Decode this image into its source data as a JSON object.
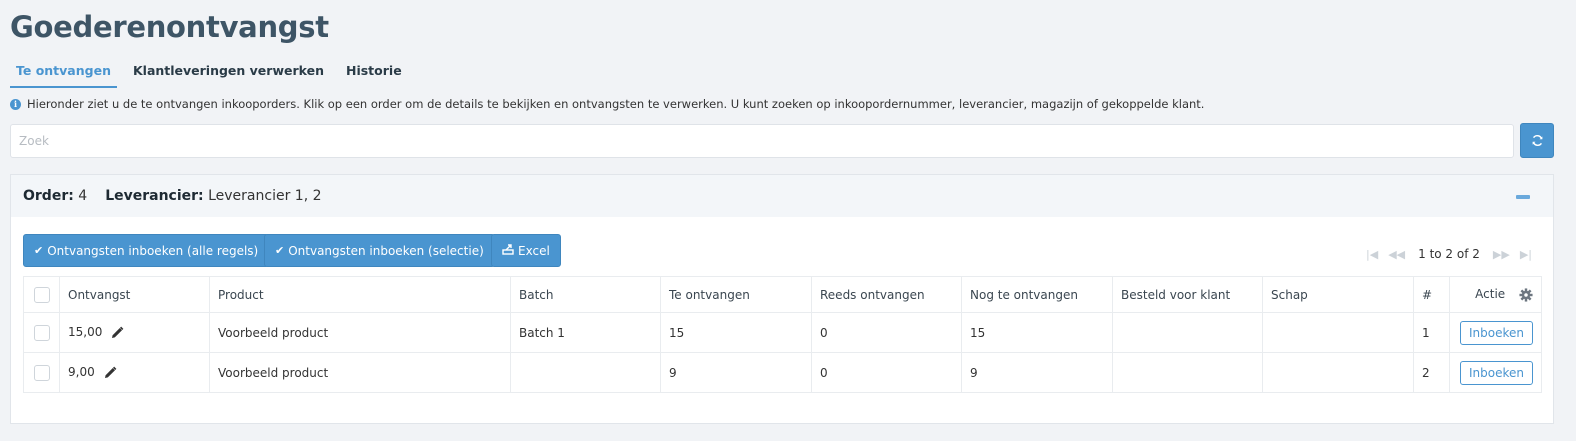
{
  "page": {
    "title": "Goederenontvangst"
  },
  "tabs": [
    {
      "label": "Te ontvangen",
      "active": true
    },
    {
      "label": "Klantleveringen verwerken",
      "active": false
    },
    {
      "label": "Historie",
      "active": false
    }
  ],
  "info": {
    "icon": "info-icon",
    "text": "Hieronder ziet u de te ontvangen inkooporders. Klik op een order om de details te bekijken en ontvangsten te verwerken. U kunt zoeken op inkoopordernummer, leverancier, magazijn of gekoppelde klant."
  },
  "search": {
    "placeholder": "Zoek",
    "value": "",
    "refresh_icon": "refresh-icon"
  },
  "order": {
    "order_label": "Order:",
    "order_value": "4",
    "supplier_label": "Leverancier:",
    "supplier_value": "Leverancier 1, 2",
    "collapse_icon": "minus-icon"
  },
  "toolbar": {
    "book_all": "Ontvangsten inboeken (alle regels)",
    "book_selection": "Ontvangsten inboeken (selectie)",
    "excel": "Excel"
  },
  "pagination": {
    "text": "1 to 2 of 2"
  },
  "table": {
    "headers": {
      "ontvangst": "Ontvangst",
      "product": "Product",
      "batch": "Batch",
      "te_ontvangen": "Te ontvangen",
      "reeds_ontvangen": "Reeds ontvangen",
      "nog_te_ontvangen": "Nog te ontvangen",
      "besteld_voor_klant": "Besteld voor klant",
      "schap": "Schap",
      "nr": "#",
      "actie": "Actie"
    },
    "rows": [
      {
        "ontvangst": "15,00",
        "product": "Voorbeeld product",
        "batch": "Batch 1",
        "te_ontvangen": "15",
        "reeds_ontvangen": "0",
        "nog_te_ontvangen": "15",
        "besteld_voor_klant": "",
        "schap": "",
        "nr": "1",
        "action": "Inboeken"
      },
      {
        "ontvangst": "9,00",
        "product": "Voorbeeld product",
        "batch": "",
        "te_ontvangen": "9",
        "reeds_ontvangen": "0",
        "nog_te_ontvangen": "9",
        "besteld_voor_klant": "",
        "schap": "",
        "nr": "2",
        "action": "Inboeken"
      }
    ]
  },
  "colors": {
    "accent": "#4a95d0",
    "title": "#3e5566",
    "background": "#f1f3f6"
  }
}
